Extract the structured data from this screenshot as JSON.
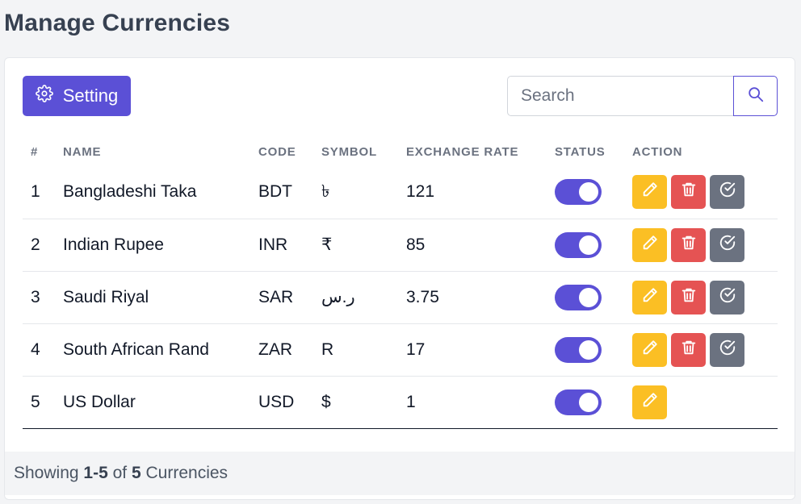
{
  "page": {
    "title": "Manage Currencies"
  },
  "toolbar": {
    "setting_label": "Setting",
    "search_placeholder": "Search",
    "search_value": ""
  },
  "table": {
    "headers": {
      "num": "#",
      "name": "NAME",
      "code": "CODE",
      "symbol": "SYMBOL",
      "rate": "EXCHANGE RATE",
      "status": "STATUS",
      "action": "ACTION"
    },
    "rows": [
      {
        "num": "1",
        "name": "Bangladeshi Taka",
        "code": "BDT",
        "symbol": "৳",
        "rate": "121",
        "status": true,
        "actions": [
          "edit",
          "delete",
          "set-default"
        ]
      },
      {
        "num": "2",
        "name": "Indian Rupee",
        "code": "INR",
        "symbol": "₹",
        "rate": "85",
        "status": true,
        "actions": [
          "edit",
          "delete",
          "set-default"
        ]
      },
      {
        "num": "3",
        "name": "Saudi Riyal",
        "code": "SAR",
        "symbol": "ر.س",
        "rate": "3.75",
        "status": true,
        "actions": [
          "edit",
          "delete",
          "set-default"
        ]
      },
      {
        "num": "4",
        "name": "South African Rand",
        "code": "ZAR",
        "symbol": "R",
        "rate": "17",
        "status": true,
        "actions": [
          "edit",
          "delete",
          "set-default"
        ]
      },
      {
        "num": "5",
        "name": "US Dollar",
        "code": "USD",
        "symbol": "$",
        "rate": "1",
        "status": true,
        "actions": [
          "edit"
        ]
      }
    ]
  },
  "footer": {
    "prefix": "Showing",
    "range": "1-5",
    "of": "of",
    "total": "5",
    "suffix": "Currencies"
  },
  "colors": {
    "primary": "#5b50d6",
    "edit": "#fbbf24",
    "delete": "#e55353",
    "default": "#6b7280"
  }
}
